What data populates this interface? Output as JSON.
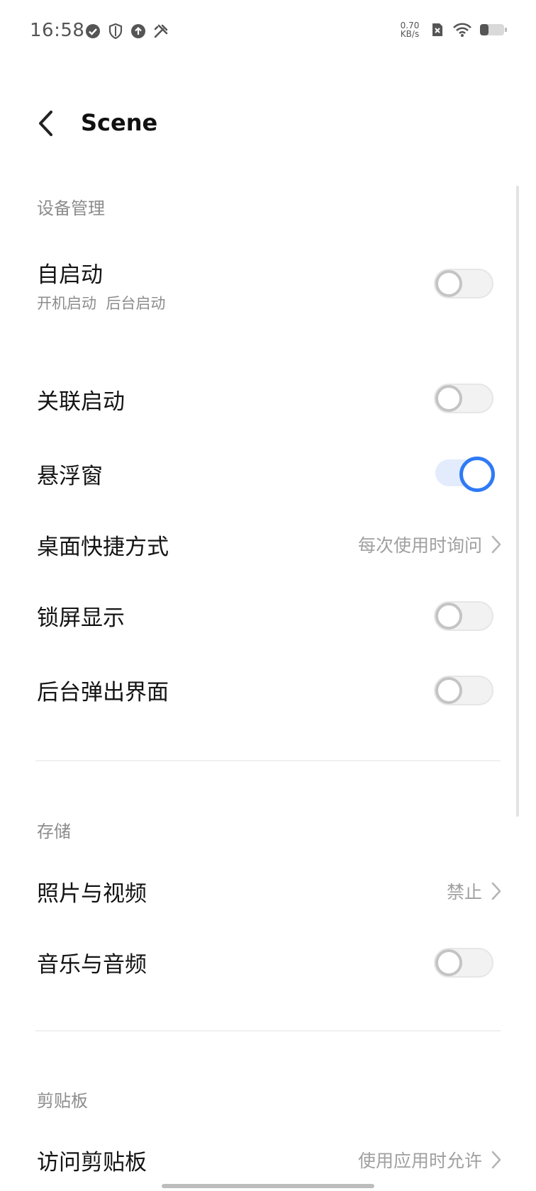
{
  "status_bar": {
    "time": "16:58",
    "net_speed_value": "0.70",
    "net_speed_unit": "KB/s",
    "icons_left": [
      "check-circle-icon",
      "shield-icon",
      "upload-icon",
      "tools-icon"
    ],
    "icons_right": [
      "sim-off-icon",
      "wifi-icon",
      "battery-icon"
    ]
  },
  "header": {
    "title": "Scene"
  },
  "sections": {
    "device": {
      "label": "设备管理",
      "autostart": {
        "title": "自启动",
        "subtitle": "开机启动  后台启动",
        "enabled": false
      },
      "linked_start": {
        "title": "关联启动",
        "enabled": false
      },
      "floating_window": {
        "title": "悬浮窗",
        "enabled": true
      },
      "desktop_shortcut": {
        "title": "桌面快捷方式",
        "value": "每次使用时询问"
      },
      "lock_screen": {
        "title": "锁屏显示",
        "enabled": false
      },
      "background_popup": {
        "title": "后台弹出界面",
        "enabled": false
      }
    },
    "storage": {
      "label": "存储",
      "photos_videos": {
        "title": "照片与视频",
        "value": "禁止"
      },
      "music_audio": {
        "title": "音乐与音频",
        "enabled": false
      }
    },
    "clipboard": {
      "label": "剪贴板",
      "access_clipboard": {
        "title": "访问剪贴板",
        "value": "使用应用时允许"
      }
    }
  },
  "colors": {
    "accent": "#2f7af5",
    "toggle_on_track": "#e3ecfc",
    "secondary_text": "#8c8c8c"
  }
}
